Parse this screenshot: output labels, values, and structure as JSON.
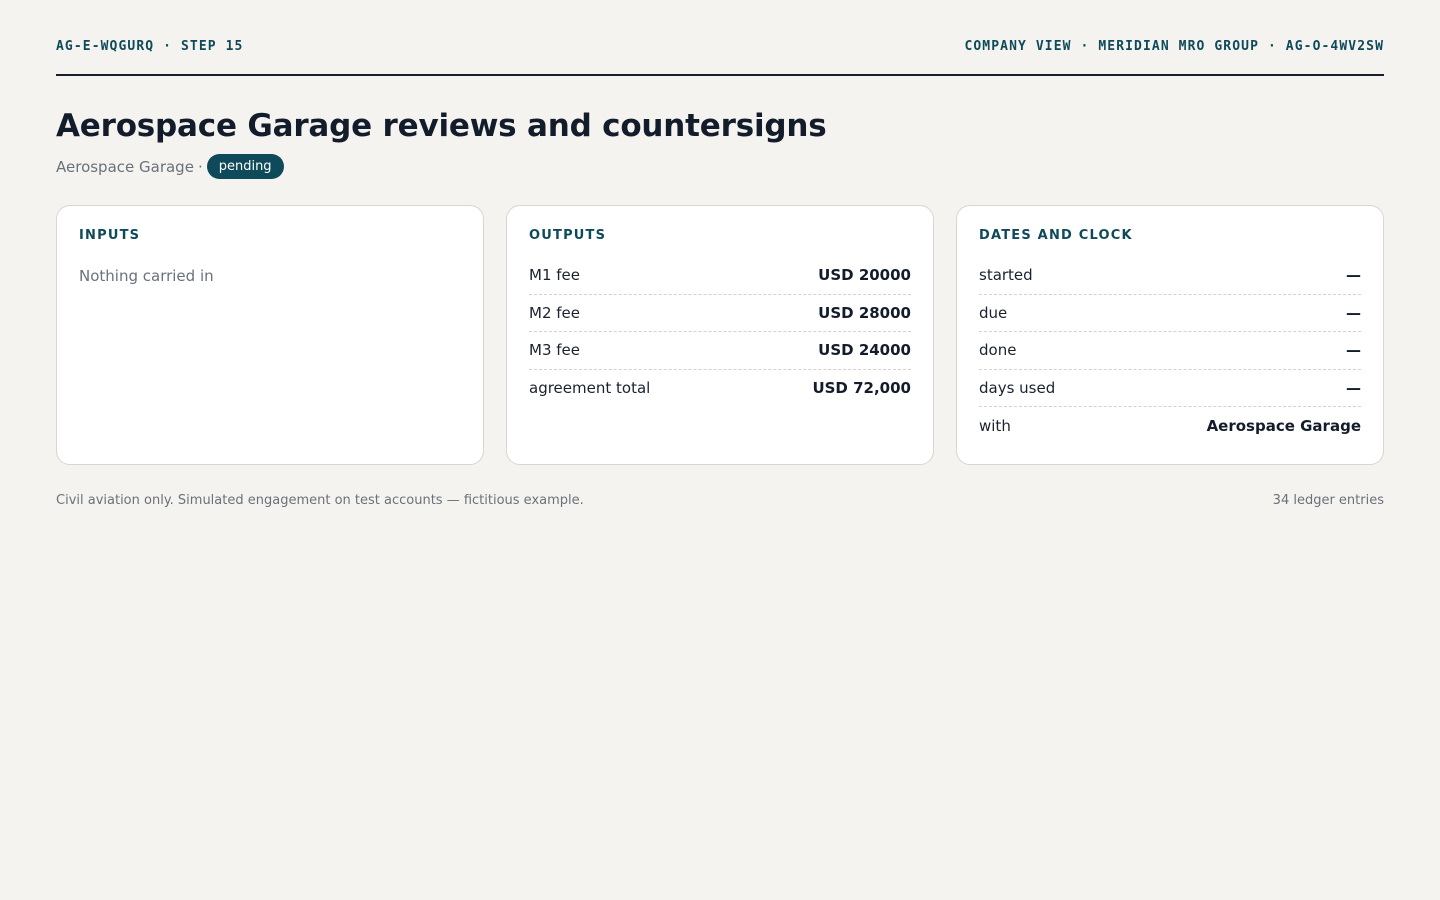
{
  "header": {
    "left": "AG-E-WQGURQ · STEP 15",
    "right": "COMPANY VIEW · MERIDIAN MRO GROUP · AG-O-4WV2SW"
  },
  "title": "Aerospace Garage reviews and countersigns",
  "subline": {
    "party": "Aerospace Garage",
    "separator": "·",
    "status": "pending"
  },
  "inputs": {
    "title": "INPUTS",
    "empty_text": "Nothing carried in"
  },
  "outputs": {
    "title": "OUTPUTS",
    "rows": [
      {
        "label": "M1 fee",
        "value": "USD 20000"
      },
      {
        "label": "M2 fee",
        "value": "USD 28000"
      },
      {
        "label": "M3 fee",
        "value": "USD 24000"
      },
      {
        "label": "agreement total",
        "value": "USD 72,000"
      }
    ]
  },
  "dates": {
    "title": "DATES AND CLOCK",
    "rows": [
      {
        "label": "started",
        "value": "—"
      },
      {
        "label": "due",
        "value": "—"
      },
      {
        "label": "done",
        "value": "—"
      },
      {
        "label": "days used",
        "value": "—"
      },
      {
        "label": "with",
        "value": "Aerospace Garage"
      }
    ]
  },
  "footer": {
    "disclaimer": "Civil aviation only. Simulated engagement on test accounts — fictitious example.",
    "ledger": "34 ledger entries"
  },
  "colors": {
    "accent": "#0f4a5a",
    "background": "#f4f3ef"
  }
}
